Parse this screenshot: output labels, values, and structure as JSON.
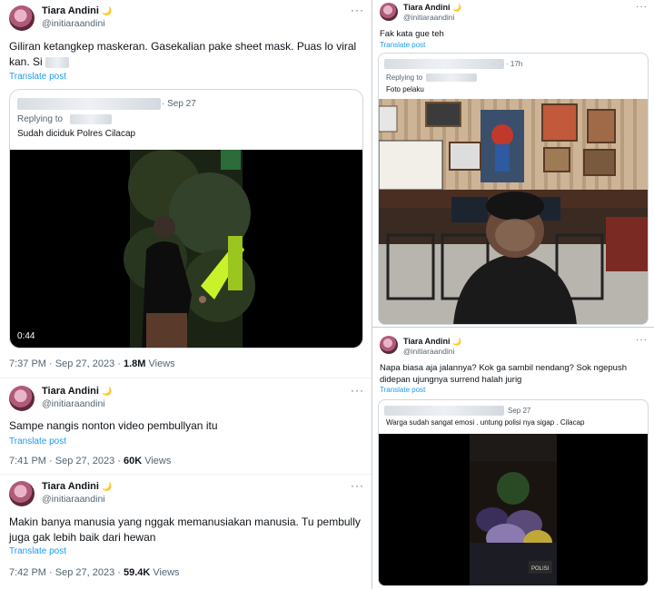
{
  "left": {
    "tweet1": {
      "name": "Tiara Andini",
      "moon": "🌙",
      "handle": "@initiaraandini",
      "more": "···",
      "text": "Giliran ketangkep maskeran. Gasekalian pake sheet mask. Puas lo viral kan. Si",
      "translate": "Translate post",
      "quote": {
        "date": "· Sep 27",
        "replying": "Replying to",
        "text": "Sudah diciduk Polres Cilacap",
        "duration": "0:44"
      },
      "time": "7:37 PM · Sep 27, 2023 · ",
      "views_count": "1.8M",
      "views_label": " Views"
    },
    "tweet2": {
      "name": "Tiara Andini",
      "moon": "🌙",
      "handle": "@initiaraandini",
      "more": "···",
      "text": "Sampe nangis nonton video pembullyan itu",
      "translate": "Translate post",
      "time": "7:41 PM · Sep 27, 2023 · ",
      "views_count": "60K",
      "views_label": " Views"
    },
    "tweet3": {
      "name": "Tiara Andini",
      "moon": "🌙",
      "handle": "@initiaraandini",
      "more": "···",
      "text": "Makin banya manusia yang nggak memanusiakan manusia. Tu pembully juga gak lebih baik dari hewan",
      "translate": "Translate post",
      "time": "7:42 PM · Sep 27, 2023 · ",
      "views_count": "59.4K",
      "views_label": " Views"
    }
  },
  "right": {
    "tweet1": {
      "name": "Tiara Andini",
      "moon": "🌙",
      "handle": "@initiaraandini",
      "more": "···",
      "text": "Fak kata gue teh",
      "translate": "Translate post",
      "quote": {
        "date": "· 17h",
        "replying": "Replying to",
        "text": "Foto pelaku"
      }
    },
    "tweet2": {
      "name": "Tiara Andini",
      "moon": "🌙",
      "handle": "@initiaraandini",
      "more": "···",
      "text": "Napa biasa aja jalannya? Kok ga sambil nendang? Sok ngepush didepan ujungnya surrend halah jurig",
      "translate": "Translate post",
      "quote": {
        "date": "Sep 27",
        "text": "Warga sudah sangat emosi . untung polisi nya sigap . Cilacap"
      }
    }
  }
}
